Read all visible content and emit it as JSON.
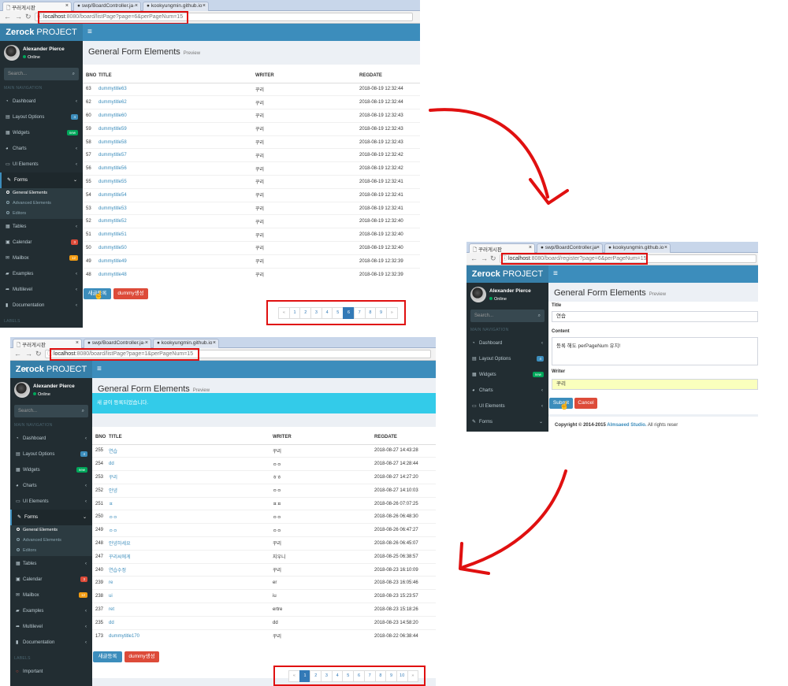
{
  "screen1": {
    "tabs": [
      "꾸러게시판",
      "swp/BoardController.ja·",
      "kookyungmin.github.io"
    ],
    "url_host": "localhost",
    "url_rest": ":8080/board/listPage?page=6&perPageNum=15",
    "brand_bold": "Zerock",
    "brand_rest": " PROJECT",
    "user_name": "Alexander Pierce",
    "user_status": "Online",
    "search_placeholder": "Search...",
    "main_nav": "MAIN NAVIGATION",
    "menu": [
      {
        "label": "Dashboard",
        "icon": "dashboard-icon",
        "badge": "",
        "badge_color": ""
      },
      {
        "label": "Layout Options",
        "icon": "files-icon",
        "badge": "4",
        "badge_color": "#3c8dbc"
      },
      {
        "label": "Widgets",
        "icon": "grid-icon",
        "badge": "new",
        "badge_color": "#00a65a"
      },
      {
        "label": "Charts",
        "icon": "pie-chart-icon",
        "badge": "",
        "badge_color": ""
      },
      {
        "label": "UI Elements",
        "icon": "laptop-icon",
        "badge": "",
        "badge_color": ""
      },
      {
        "label": "Forms",
        "icon": "edit-icon",
        "badge": "",
        "badge_color": ""
      },
      {
        "label": "Tables",
        "icon": "table-icon",
        "badge": "",
        "badge_color": ""
      },
      {
        "label": "Calendar",
        "icon": "calendar-icon",
        "badge": "3",
        "badge_color": "#dd4b39"
      },
      {
        "label": "Mailbox",
        "icon": "envelope-icon",
        "badge": "12",
        "badge_color": "#f39c12"
      },
      {
        "label": "Examples",
        "icon": "folder-icon",
        "badge": "",
        "badge_color": ""
      },
      {
        "label": "Multilevel",
        "icon": "share-icon",
        "badge": "",
        "badge_color": ""
      },
      {
        "label": "Documentation",
        "icon": "book-icon",
        "badge": "",
        "badge_color": ""
      }
    ],
    "forms_sub": [
      "General Elements",
      "Advanced Elements",
      "Editors"
    ],
    "labels_header": "LABELS",
    "page_title": "General Form Elements",
    "page_subtitle": "Preview",
    "cols": [
      "BNO",
      "TITLE",
      "WRITER",
      "REGDATE"
    ],
    "rows": [
      [
        "63",
        "dummytitle63",
        "꾸리",
        "2018-08-19 12:32:44"
      ],
      [
        "62",
        "dummytitle62",
        "꾸리",
        "2018-08-19 12:32:44"
      ],
      [
        "60",
        "dummytitle60",
        "꾸리",
        "2018-08-19 12:32:43"
      ],
      [
        "59",
        "dummytitle59",
        "꾸리",
        "2018-08-19 12:32:43"
      ],
      [
        "58",
        "dummytitle58",
        "꾸리",
        "2018-08-19 12:32:43"
      ],
      [
        "57",
        "dummytitle57",
        "꾸리",
        "2018-08-19 12:32:42"
      ],
      [
        "56",
        "dummytitle56",
        "꾸리",
        "2018-08-19 12:32:42"
      ],
      [
        "55",
        "dummytitle55",
        "꾸리",
        "2018-08-19 12:32:41"
      ],
      [
        "54",
        "dummytitle54",
        "꾸리",
        "2018-08-19 12:32:41"
      ],
      [
        "53",
        "dummytitle53",
        "꾸리",
        "2018-08-19 12:32:41"
      ],
      [
        "52",
        "dummytitle52",
        "꾸리",
        "2018-08-19 12:32:40"
      ],
      [
        "51",
        "dummytitle51",
        "꾸리",
        "2018-08-19 12:32:40"
      ],
      [
        "50",
        "dummytitle50",
        "꾸리",
        "2018-08-19 12:32:40"
      ],
      [
        "49",
        "dummytitle49",
        "꾸리",
        "2018-08-19 12:32:39"
      ],
      [
        "48",
        "dummytitle48",
        "꾸리",
        "2018-08-19 12:32:39"
      ]
    ],
    "btn_new": "새글등록",
    "btn_dummy": "dummy생성",
    "pages": [
      "«",
      "1",
      "2",
      "3",
      "4",
      "5",
      "6",
      "7",
      "8",
      "9",
      "»"
    ],
    "current_page": "6"
  },
  "screen2": {
    "tabs": [
      "꾸러게시판",
      "swp/BoardController.ja·",
      "kookyungmin.github.io"
    ],
    "url_host": "localhost",
    "url_rest": ":8080/board/register?page=6&perPageNum=15",
    "brand_bold": "Zerock",
    "brand_rest": " PROJECT",
    "user_name": "Alexander Pierce",
    "user_status": "Online",
    "search_placeholder": "Search...",
    "main_nav": "MAIN NAVIGATION",
    "menu": [
      {
        "label": "Dashboard",
        "icon": "dashboard-icon",
        "badge": "",
        "badge_color": ""
      },
      {
        "label": "Layout Options",
        "icon": "files-icon",
        "badge": "4",
        "badge_color": "#3c8dbc"
      },
      {
        "label": "Widgets",
        "icon": "grid-icon",
        "badge": "new",
        "badge_color": "#00a65a"
      },
      {
        "label": "Charts",
        "icon": "pie-chart-icon",
        "badge": "",
        "badge_color": ""
      },
      {
        "label": "UI Elements",
        "icon": "laptop-icon",
        "badge": "",
        "badge_color": ""
      },
      {
        "label": "Forms",
        "icon": "edit-icon",
        "badge": "",
        "badge_color": ""
      }
    ],
    "page_title": "General Form Elements",
    "page_subtitle": "Preview",
    "title_label": "Title",
    "title_value": "연습",
    "content_label": "Content",
    "content_value": "등록 해도 perPageNum 유지!",
    "writer_label": "Writer",
    "writer_value": "꾸리",
    "btn_submit": "Submit",
    "btn_cancel": "Cancel",
    "copyright_prefix": "Copyright © 2014-2015 ",
    "copyright_link": "Almsaeed Studio.",
    "copyright_suffix": " All rights reser"
  },
  "screen3": {
    "tabs": [
      "꾸러게시판",
      "swp/BoardController.ja·",
      "kookyungmin.github.io"
    ],
    "url_host": "localhost",
    "url_rest": ":8080/board/listPage?page=1&perPageNum=15",
    "brand_bold": "Zerock",
    "brand_rest": " PROJECT",
    "user_name": "Alexander Pierce",
    "user_status": "Online",
    "search_placeholder": "Search...",
    "main_nav": "MAIN NAVIGATION",
    "menu": [
      {
        "label": "Dashboard",
        "icon": "dashboard-icon",
        "badge": "",
        "badge_color": ""
      },
      {
        "label": "Layout Options",
        "icon": "files-icon",
        "badge": "4",
        "badge_color": "#3c8dbc"
      },
      {
        "label": "Widgets",
        "icon": "grid-icon",
        "badge": "new",
        "badge_color": "#00a65a"
      },
      {
        "label": "Charts",
        "icon": "pie-chart-icon",
        "badge": "",
        "badge_color": ""
      },
      {
        "label": "UI Elements",
        "icon": "laptop-icon",
        "badge": "",
        "badge_color": ""
      },
      {
        "label": "Forms",
        "icon": "edit-icon",
        "badge": "",
        "badge_color": ""
      },
      {
        "label": "Tables",
        "icon": "table-icon",
        "badge": "",
        "badge_color": ""
      },
      {
        "label": "Calendar",
        "icon": "calendar-icon",
        "badge": "3",
        "badge_color": "#dd4b39"
      },
      {
        "label": "Mailbox",
        "icon": "envelope-icon",
        "badge": "12",
        "badge_color": "#f39c12"
      },
      {
        "label": "Examples",
        "icon": "folder-icon",
        "badge": "",
        "badge_color": ""
      },
      {
        "label": "Multilevel",
        "icon": "share-icon",
        "badge": "",
        "badge_color": ""
      },
      {
        "label": "Documentation",
        "icon": "book-icon",
        "badge": "",
        "badge_color": ""
      }
    ],
    "forms_sub": [
      "General Elements",
      "Advanced Elements",
      "Editors"
    ],
    "labels_header": "LABELS",
    "labels_item": "Important",
    "page_title": "General Form Elements",
    "page_subtitle": "Preview",
    "alert": "새 글이 등록되었습니다.",
    "cols": [
      "BNO",
      "TITLE",
      "WRITER",
      "REGDATE"
    ],
    "rows": [
      [
        "255",
        "연습",
        "꾸리",
        "2018-08-27 14:43:28"
      ],
      [
        "254",
        "dd",
        "ㅇㅇ",
        "2018-08-27 14:28:44"
      ],
      [
        "253",
        "꾸리",
        "ㅎㅎ",
        "2018-08-27 14:27:20"
      ],
      [
        "252",
        "안녕",
        "ㅇㅇ",
        "2018-08-27 14:10:03"
      ],
      [
        "251",
        "ㅍ",
        "ㅍㅍ",
        "2018-08-26 07:07:25"
      ],
      [
        "250",
        "ㅇㅇ",
        "ㅇㅇ",
        "2018-08-26 06:48:30"
      ],
      [
        "249",
        "ㅇㅇ",
        "ㅇㅇ",
        "2018-08-26 06:47:27"
      ],
      [
        "248",
        "안녕하세요",
        "꾸리",
        "2018-08-26 06:45:07"
      ],
      [
        "247",
        "꾸리씨에게",
        "지우니",
        "2018-08-25 06:38:57"
      ],
      [
        "240",
        "연습수정",
        "꾸리",
        "2018-08-23 16:10:09"
      ],
      [
        "239",
        "re",
        "er",
        "2018-08-23 16:05:46"
      ],
      [
        "238",
        "ui",
        "iu",
        "2018-08-23 15:23:57"
      ],
      [
        "237",
        "ret",
        "ertre",
        "2018-08-23 15:18:26"
      ],
      [
        "235",
        "dd",
        "dd",
        "2018-08-23 14:58:20"
      ],
      [
        "173",
        "dummytitle170",
        "꾸리",
        "2018-08-22 06:38:44"
      ]
    ],
    "btn_new": "새글등록",
    "btn_dummy": "dummy생성",
    "pages": [
      "«",
      "1",
      "2",
      "3",
      "4",
      "5",
      "6",
      "7",
      "8",
      "9",
      "10",
      "»"
    ],
    "current_page": "1"
  },
  "colors": {
    "accent": "#3c8dbc",
    "sidebar": "#222d32",
    "danger": "#dd4b39",
    "annotation": "#e01010"
  }
}
